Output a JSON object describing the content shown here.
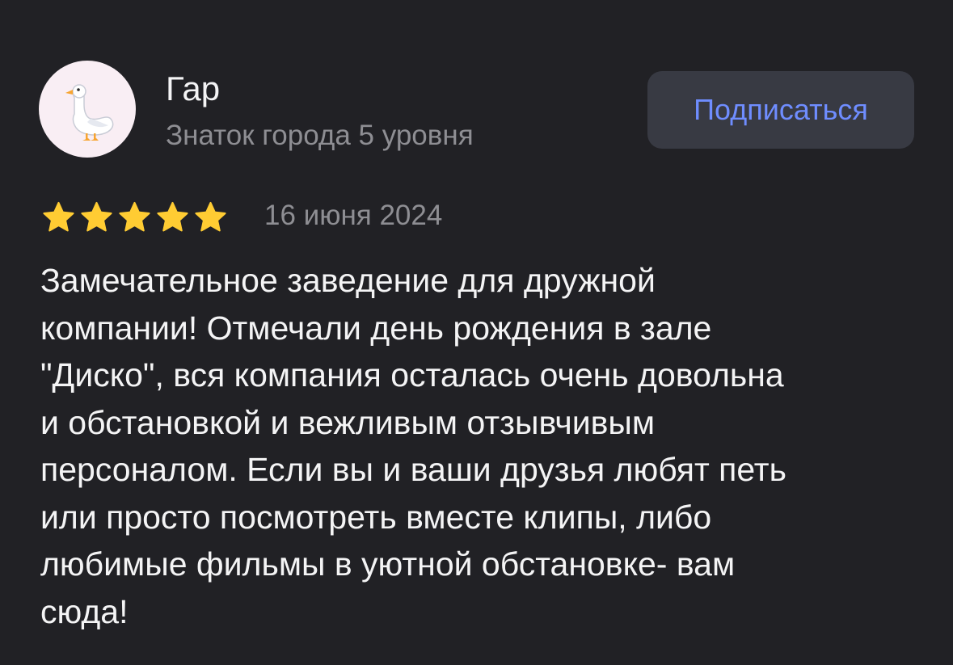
{
  "author": {
    "name": "Гар",
    "level": "Знаток города 5 уровня",
    "avatar_icon": "goose-icon",
    "avatar_bg": "#f9eef4"
  },
  "subscribe_button": {
    "label": "Подписаться",
    "color": "#6f8dff",
    "bg": "#383a43"
  },
  "rating": {
    "stars": 5,
    "max": 5,
    "star_color": "#ffcc33",
    "icon": "star-icon"
  },
  "date": "16 июня 2024",
  "text": "Замечательное заведение для дружной\nкомпании! Отмечали день рождения в зале\n\"Диско\", вся компания осталась очень довольна\nи обстановкой и вежливым отзывчивым\nперсоналом. Если вы и ваши друзья любят петь\nили просто посмотреть вместе клипы, либо\nлюбимые фильмы в уютной обстановке- вам\nсюда!",
  "colors": {
    "background": "#212125",
    "text_primary": "#f4f4f5",
    "text_secondary": "#8e8e93"
  }
}
